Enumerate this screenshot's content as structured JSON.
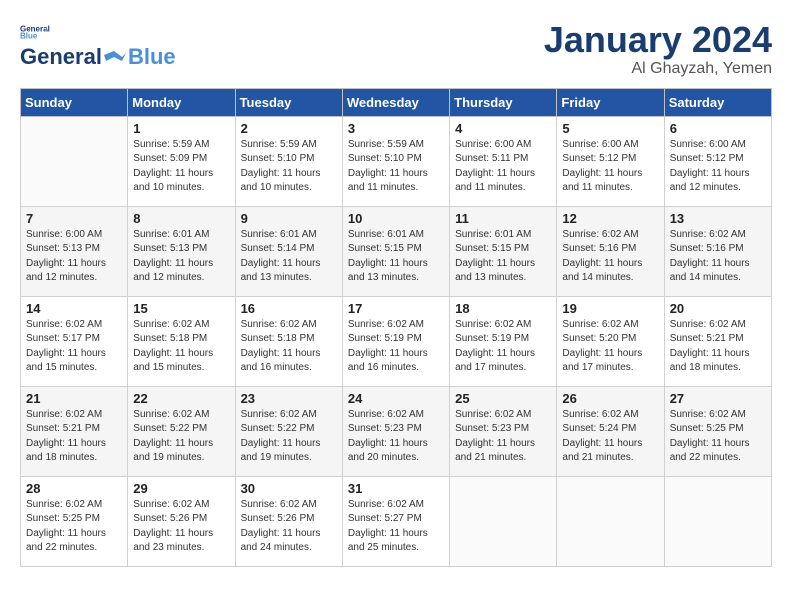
{
  "header": {
    "logo_line1": "General",
    "logo_line2": "Blue",
    "month": "January 2024",
    "location": "Al Ghayzah, Yemen"
  },
  "days_of_week": [
    "Sunday",
    "Monday",
    "Tuesday",
    "Wednesday",
    "Thursday",
    "Friday",
    "Saturday"
  ],
  "weeks": [
    [
      {
        "num": "",
        "detail": ""
      },
      {
        "num": "1",
        "detail": "Sunrise: 5:59 AM\nSunset: 5:09 PM\nDaylight: 11 hours\nand 10 minutes."
      },
      {
        "num": "2",
        "detail": "Sunrise: 5:59 AM\nSunset: 5:10 PM\nDaylight: 11 hours\nand 10 minutes."
      },
      {
        "num": "3",
        "detail": "Sunrise: 5:59 AM\nSunset: 5:10 PM\nDaylight: 11 hours\nand 11 minutes."
      },
      {
        "num": "4",
        "detail": "Sunrise: 6:00 AM\nSunset: 5:11 PM\nDaylight: 11 hours\nand 11 minutes."
      },
      {
        "num": "5",
        "detail": "Sunrise: 6:00 AM\nSunset: 5:12 PM\nDaylight: 11 hours\nand 11 minutes."
      },
      {
        "num": "6",
        "detail": "Sunrise: 6:00 AM\nSunset: 5:12 PM\nDaylight: 11 hours\nand 12 minutes."
      }
    ],
    [
      {
        "num": "7",
        "detail": "Sunrise: 6:00 AM\nSunset: 5:13 PM\nDaylight: 11 hours\nand 12 minutes."
      },
      {
        "num": "8",
        "detail": "Sunrise: 6:01 AM\nSunset: 5:13 PM\nDaylight: 11 hours\nand 12 minutes."
      },
      {
        "num": "9",
        "detail": "Sunrise: 6:01 AM\nSunset: 5:14 PM\nDaylight: 11 hours\nand 13 minutes."
      },
      {
        "num": "10",
        "detail": "Sunrise: 6:01 AM\nSunset: 5:15 PM\nDaylight: 11 hours\nand 13 minutes."
      },
      {
        "num": "11",
        "detail": "Sunrise: 6:01 AM\nSunset: 5:15 PM\nDaylight: 11 hours\nand 13 minutes."
      },
      {
        "num": "12",
        "detail": "Sunrise: 6:02 AM\nSunset: 5:16 PM\nDaylight: 11 hours\nand 14 minutes."
      },
      {
        "num": "13",
        "detail": "Sunrise: 6:02 AM\nSunset: 5:16 PM\nDaylight: 11 hours\nand 14 minutes."
      }
    ],
    [
      {
        "num": "14",
        "detail": "Sunrise: 6:02 AM\nSunset: 5:17 PM\nDaylight: 11 hours\nand 15 minutes."
      },
      {
        "num": "15",
        "detail": "Sunrise: 6:02 AM\nSunset: 5:18 PM\nDaylight: 11 hours\nand 15 minutes."
      },
      {
        "num": "16",
        "detail": "Sunrise: 6:02 AM\nSunset: 5:18 PM\nDaylight: 11 hours\nand 16 minutes."
      },
      {
        "num": "17",
        "detail": "Sunrise: 6:02 AM\nSunset: 5:19 PM\nDaylight: 11 hours\nand 16 minutes."
      },
      {
        "num": "18",
        "detail": "Sunrise: 6:02 AM\nSunset: 5:19 PM\nDaylight: 11 hours\nand 17 minutes."
      },
      {
        "num": "19",
        "detail": "Sunrise: 6:02 AM\nSunset: 5:20 PM\nDaylight: 11 hours\nand 17 minutes."
      },
      {
        "num": "20",
        "detail": "Sunrise: 6:02 AM\nSunset: 5:21 PM\nDaylight: 11 hours\nand 18 minutes."
      }
    ],
    [
      {
        "num": "21",
        "detail": "Sunrise: 6:02 AM\nSunset: 5:21 PM\nDaylight: 11 hours\nand 18 minutes."
      },
      {
        "num": "22",
        "detail": "Sunrise: 6:02 AM\nSunset: 5:22 PM\nDaylight: 11 hours\nand 19 minutes."
      },
      {
        "num": "23",
        "detail": "Sunrise: 6:02 AM\nSunset: 5:22 PM\nDaylight: 11 hours\nand 19 minutes."
      },
      {
        "num": "24",
        "detail": "Sunrise: 6:02 AM\nSunset: 5:23 PM\nDaylight: 11 hours\nand 20 minutes."
      },
      {
        "num": "25",
        "detail": "Sunrise: 6:02 AM\nSunset: 5:23 PM\nDaylight: 11 hours\nand 21 minutes."
      },
      {
        "num": "26",
        "detail": "Sunrise: 6:02 AM\nSunset: 5:24 PM\nDaylight: 11 hours\nand 21 minutes."
      },
      {
        "num": "27",
        "detail": "Sunrise: 6:02 AM\nSunset: 5:25 PM\nDaylight: 11 hours\nand 22 minutes."
      }
    ],
    [
      {
        "num": "28",
        "detail": "Sunrise: 6:02 AM\nSunset: 5:25 PM\nDaylight: 11 hours\nand 22 minutes."
      },
      {
        "num": "29",
        "detail": "Sunrise: 6:02 AM\nSunset: 5:26 PM\nDaylight: 11 hours\nand 23 minutes."
      },
      {
        "num": "30",
        "detail": "Sunrise: 6:02 AM\nSunset: 5:26 PM\nDaylight: 11 hours\nand 24 minutes."
      },
      {
        "num": "31",
        "detail": "Sunrise: 6:02 AM\nSunset: 5:27 PM\nDaylight: 11 hours\nand 25 minutes."
      },
      {
        "num": "",
        "detail": ""
      },
      {
        "num": "",
        "detail": ""
      },
      {
        "num": "",
        "detail": ""
      }
    ]
  ]
}
